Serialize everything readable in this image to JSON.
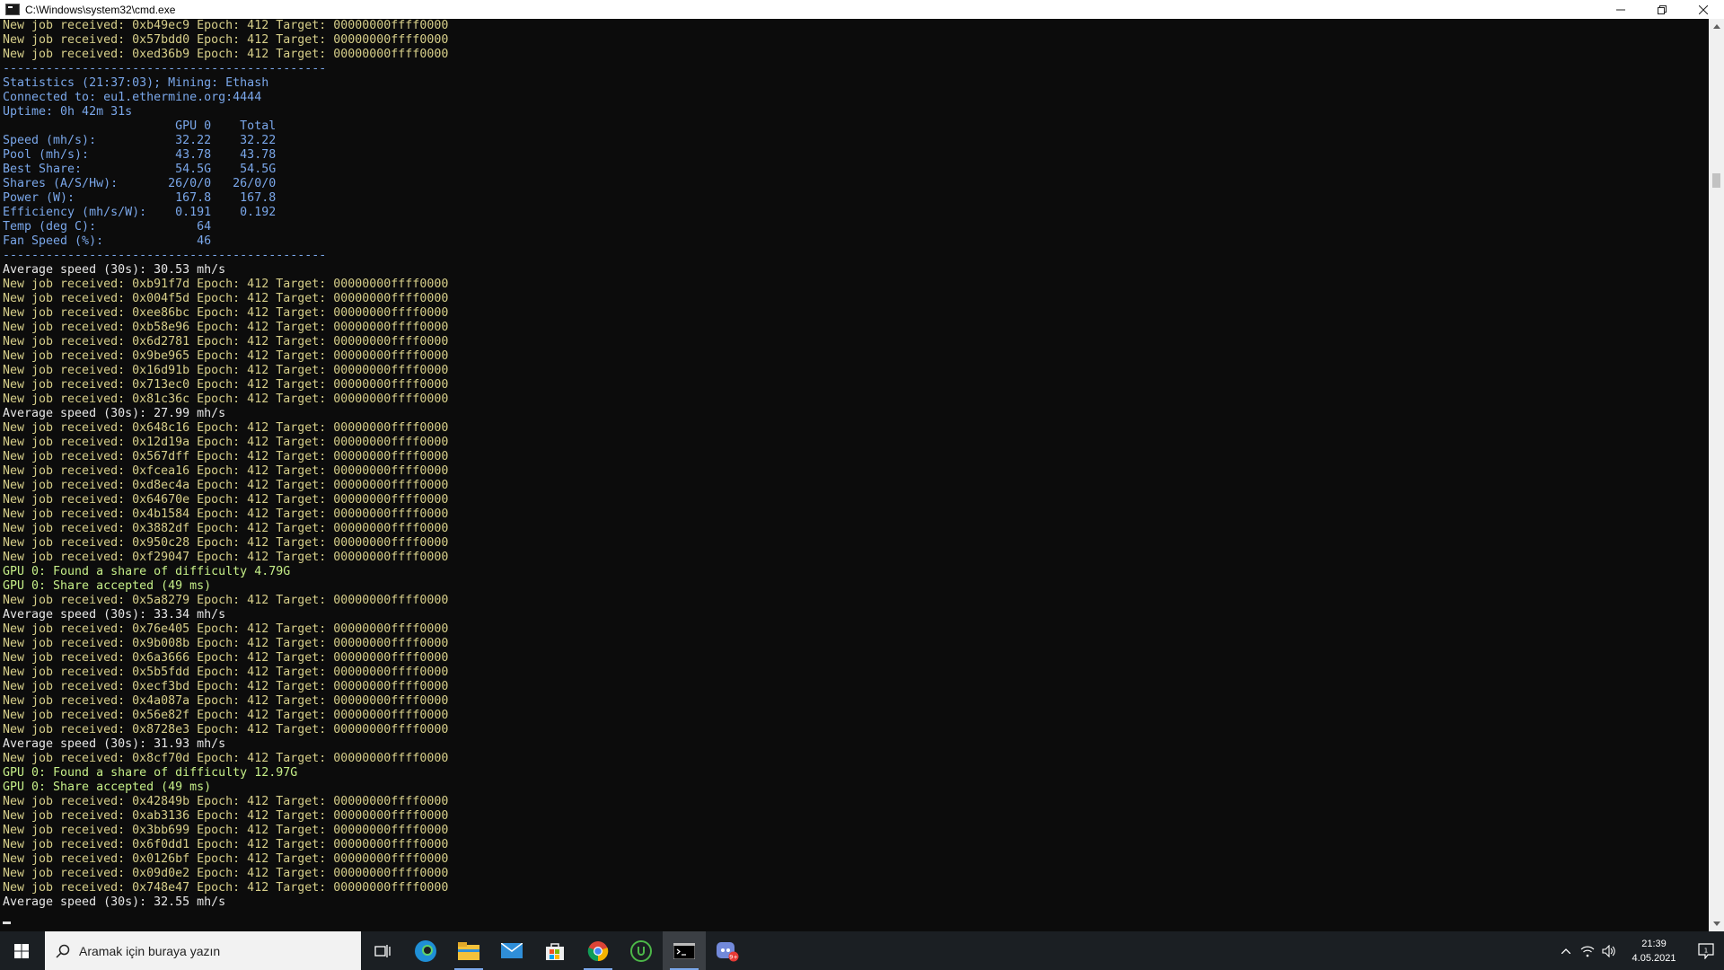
{
  "window": {
    "title": "C:\\Windows\\system32\\cmd.exe",
    "minimize_icon": "minimize-icon",
    "restore_icon": "restore-icon",
    "close_icon": "close-icon"
  },
  "colors": {
    "console_bg": "#0c0c0c",
    "job_text": "#d7cf8a",
    "stats_text": "#7aa7ea",
    "share_text": "#c6ef88",
    "normal_text": "#e8e8e8"
  },
  "console_lines": [
    {
      "t": "New job received: 0xb49ec9 Epoch: 412 Target: 00000000ffff0000",
      "c": "job"
    },
    {
      "t": "New job received: 0x57bdd0 Epoch: 412 Target: 00000000ffff0000",
      "c": "job"
    },
    {
      "t": "New job received: 0xed36b9 Epoch: 412 Target: 00000000ffff0000",
      "c": "job"
    },
    {
      "t": "---------------------------------------------",
      "c": "blue"
    },
    {
      "t": "Statistics (21:37:03); Mining: Ethash",
      "c": "blue"
    },
    {
      "t": "Connected to: eu1.ethermine.org:4444",
      "c": "blue"
    },
    {
      "t": "Uptime: 0h 42m 31s",
      "c": "blue"
    },
    {
      "t": "                        GPU 0    Total",
      "c": "blue"
    },
    {
      "t": "Speed (mh/s):           32.22    32.22",
      "c": "blue"
    },
    {
      "t": "Pool (mh/s):            43.78    43.78",
      "c": "blue"
    },
    {
      "t": "Best Share:             54.5G    54.5G",
      "c": "blue"
    },
    {
      "t": "Shares (A/S/Hw):       26/0/0   26/0/0",
      "c": "blue"
    },
    {
      "t": "Power (W):              167.8    167.8",
      "c": "blue"
    },
    {
      "t": "Efficiency (mh/s/W):    0.191    0.192",
      "c": "blue"
    },
    {
      "t": "Temp (deg C):              64",
      "c": "blue"
    },
    {
      "t": "Fan Speed (%):             46",
      "c": "blue"
    },
    {
      "t": "---------------------------------------------",
      "c": "blue"
    },
    {
      "t": "Average speed (30s): 30.53 mh/s",
      "c": "white"
    },
    {
      "t": "New job received: 0xb91f7d Epoch: 412 Target: 00000000ffff0000",
      "c": "job"
    },
    {
      "t": "New job received: 0x004f5d Epoch: 412 Target: 00000000ffff0000",
      "c": "job"
    },
    {
      "t": "New job received: 0xee86bc Epoch: 412 Target: 00000000ffff0000",
      "c": "job"
    },
    {
      "t": "New job received: 0xb58e96 Epoch: 412 Target: 00000000ffff0000",
      "c": "job"
    },
    {
      "t": "New job received: 0x6d2781 Epoch: 412 Target: 00000000ffff0000",
      "c": "job"
    },
    {
      "t": "New job received: 0x9be965 Epoch: 412 Target: 00000000ffff0000",
      "c": "job"
    },
    {
      "t": "New job received: 0x16d91b Epoch: 412 Target: 00000000ffff0000",
      "c": "job"
    },
    {
      "t": "New job received: 0x713ec0 Epoch: 412 Target: 00000000ffff0000",
      "c": "job"
    },
    {
      "t": "New job received: 0x81c36c Epoch: 412 Target: 00000000ffff0000",
      "c": "job"
    },
    {
      "t": "Average speed (30s): 27.99 mh/s",
      "c": "white"
    },
    {
      "t": "New job received: 0x648c16 Epoch: 412 Target: 00000000ffff0000",
      "c": "job"
    },
    {
      "t": "New job received: 0x12d19a Epoch: 412 Target: 00000000ffff0000",
      "c": "job"
    },
    {
      "t": "New job received: 0x567dff Epoch: 412 Target: 00000000ffff0000",
      "c": "job"
    },
    {
      "t": "New job received: 0xfcea16 Epoch: 412 Target: 00000000ffff0000",
      "c": "job"
    },
    {
      "t": "New job received: 0xd8ec4a Epoch: 412 Target: 00000000ffff0000",
      "c": "job"
    },
    {
      "t": "New job received: 0x64670e Epoch: 412 Target: 00000000ffff0000",
      "c": "job"
    },
    {
      "t": "New job received: 0x4b1584 Epoch: 412 Target: 00000000ffff0000",
      "c": "job"
    },
    {
      "t": "New job received: 0x3882df Epoch: 412 Target: 00000000ffff0000",
      "c": "job"
    },
    {
      "t": "New job received: 0x950c28 Epoch: 412 Target: 00000000ffff0000",
      "c": "job"
    },
    {
      "t": "New job received: 0xf29047 Epoch: 412 Target: 00000000ffff0000",
      "c": "job"
    },
    {
      "t": "GPU 0: Found a share of difficulty 4.79G",
      "c": "green"
    },
    {
      "t": "GPU 0: Share accepted (49 ms)",
      "c": "green"
    },
    {
      "t": "New job received: 0x5a8279 Epoch: 412 Target: 00000000ffff0000",
      "c": "job"
    },
    {
      "t": "Average speed (30s): 33.34 mh/s",
      "c": "white"
    },
    {
      "t": "New job received: 0x76e405 Epoch: 412 Target: 00000000ffff0000",
      "c": "job"
    },
    {
      "t": "New job received: 0x9b008b Epoch: 412 Target: 00000000ffff0000",
      "c": "job"
    },
    {
      "t": "New job received: 0x6a3666 Epoch: 412 Target: 00000000ffff0000",
      "c": "job"
    },
    {
      "t": "New job received: 0x5b5fdd Epoch: 412 Target: 00000000ffff0000",
      "c": "job"
    },
    {
      "t": "New job received: 0xecf3bd Epoch: 412 Target: 00000000ffff0000",
      "c": "job"
    },
    {
      "t": "New job received: 0x4a087a Epoch: 412 Target: 00000000ffff0000",
      "c": "job"
    },
    {
      "t": "New job received: 0x56e82f Epoch: 412 Target: 00000000ffff0000",
      "c": "job"
    },
    {
      "t": "New job received: 0x8728e3 Epoch: 412 Target: 00000000ffff0000",
      "c": "job"
    },
    {
      "t": "Average speed (30s): 31.93 mh/s",
      "c": "white"
    },
    {
      "t": "New job received: 0x8cf70d Epoch: 412 Target: 00000000ffff0000",
      "c": "job"
    },
    {
      "t": "GPU 0: Found a share of difficulty 12.97G",
      "c": "green"
    },
    {
      "t": "GPU 0: Share accepted (49 ms)",
      "c": "green"
    },
    {
      "t": "New job received: 0x42849b Epoch: 412 Target: 00000000ffff0000",
      "c": "job"
    },
    {
      "t": "New job received: 0xab3136 Epoch: 412 Target: 00000000ffff0000",
      "c": "job"
    },
    {
      "t": "New job received: 0x3bb699 Epoch: 412 Target: 00000000ffff0000",
      "c": "job"
    },
    {
      "t": "New job received: 0x6f0dd1 Epoch: 412 Target: 00000000ffff0000",
      "c": "job"
    },
    {
      "t": "New job received: 0x0126bf Epoch: 412 Target: 00000000ffff0000",
      "c": "job"
    },
    {
      "t": "New job received: 0x09d0e2 Epoch: 412 Target: 00000000ffff0000",
      "c": "job"
    },
    {
      "t": "New job received: 0x748e47 Epoch: 412 Target: 00000000ffff0000",
      "c": "job"
    },
    {
      "t": "Average speed (30s): 32.55 mh/s",
      "c": "white"
    }
  ],
  "taskbar": {
    "search_placeholder": "Aramak için buraya yazın",
    "pinned_icons": [
      "windows-start-icon",
      "task-view-icon",
      "edge-browser-icon",
      "file-explorer-icon",
      "mail-icon",
      "store-icon",
      "chrome-icon",
      "utorrent-icon",
      "cmd-terminal-icon",
      "discord-icon"
    ],
    "discord_badge": "9+",
    "clock_time": "21:39",
    "clock_date": "4.05.2021"
  }
}
